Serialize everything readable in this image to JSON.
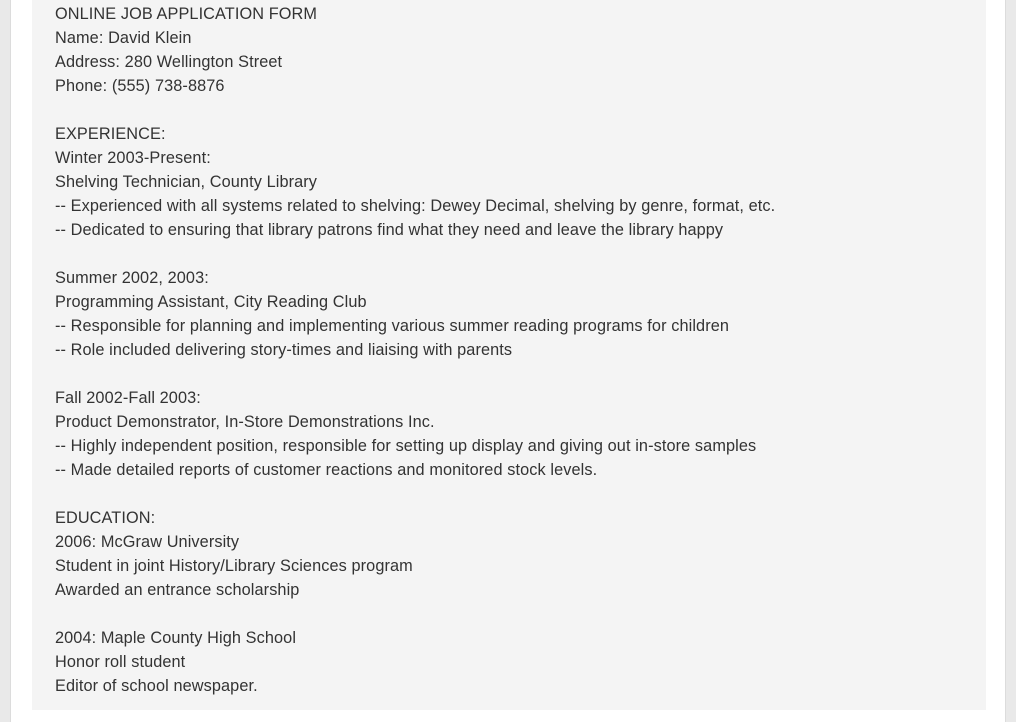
{
  "form": {
    "title": "ONLINE JOB APPLICATION FORM",
    "name": "Name: David Klein",
    "address": "Address: 280 Wellington Street",
    "phone": "Phone: (555) 738-8876"
  },
  "experience": {
    "heading": "EXPERIENCE:",
    "jobs": [
      {
        "period": "Winter 2003-Present:",
        "role": "Shelving Technician, County Library",
        "bullets": [
          "-- Experienced with all systems related to shelving: Dewey Decimal, shelving by genre, format, etc.",
          "-- Dedicated to ensuring that library patrons find what they need and leave the library happy"
        ]
      },
      {
        "period": "Summer 2002, 2003:",
        "role": "Programming Assistant, City Reading Club",
        "bullets": [
          "-- Responsible for planning and implementing various summer reading programs for children",
          "-- Role included delivering story-times and liaising with parents"
        ]
      },
      {
        "period": "Fall 2002-Fall 2003:",
        "role": "Product Demonstrator, In-Store Demonstrations Inc.",
        "bullets": [
          "-- Highly independent position, responsible for setting up display and giving out in-store samples",
          "-- Made detailed reports of customer reactions and monitored stock levels."
        ]
      }
    ]
  },
  "education": {
    "heading": "EDUCATION:",
    "schools": [
      {
        "title": "2006: McGraw University",
        "details": [
          "Student in joint History/Library Sciences program",
          "Awarded an entrance scholarship"
        ]
      },
      {
        "title": "2004: Maple County High School",
        "details": [
          "Honor roll student",
          "Editor of school newspaper."
        ]
      }
    ]
  }
}
